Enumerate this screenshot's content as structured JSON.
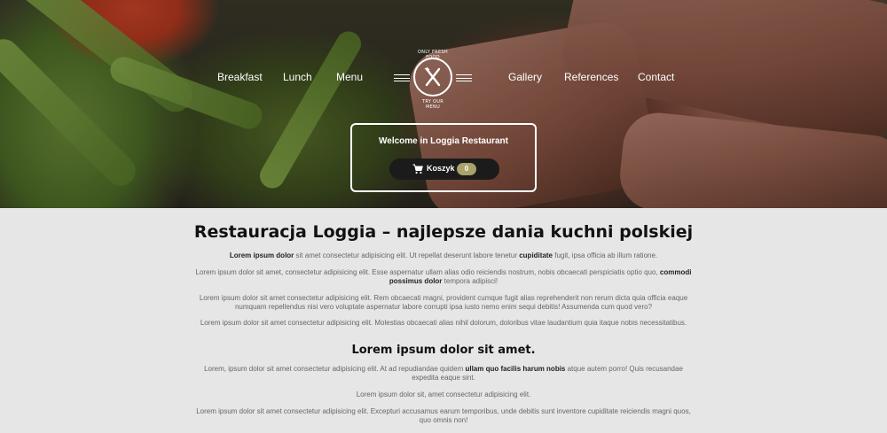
{
  "nav": {
    "breakfast": "Breakfast",
    "lunch": "Lunch",
    "menu": "Menu",
    "gallery": "Gallery",
    "references": "References",
    "contact": "Contact"
  },
  "logo": {
    "top_text": "ONLY FRESH FOOD",
    "bottom_text": "TRY OUR MENU"
  },
  "welcome": {
    "title": "Welcome in Loggia Restaurant",
    "cart_label": "Koszyk",
    "cart_count": "0"
  },
  "content": {
    "heading": "Restauracja Loggia – najlepsze dania kuchni polskiej",
    "p1_b1": "Lorem ipsum dolor",
    "p1_t1": " sit amet consectetur adipisicing elit. Ut repellat deserunt labore tenetur ",
    "p1_b2": "cupiditate",
    "p1_t2": " fugit, ipsa officia ab illum ratione.",
    "p2_t1": "Lorem ipsum dolor sit amet, consectetur adipisicing elit. Esse aspernatur ullam alias odio reiciendis nostrum, nobis obcaecati perspiciatis optio quo, ",
    "p2_b1": "commodi possimus dolor",
    "p2_t2": " tempora adipisci!",
    "p3": "Lorem ipsum dolor sit amet consectetur adipisicing elit. Rem obcaecati magni, provident cumque fugit alias reprehenderit non rerum dicta quia officia eaque numquam repellendus nisi vero voluptate aspernatur labore corrupti ipsa iusto nemo enim sequi debitis! Assumenda cum quod vero?",
    "p4": "Lorem ipsum dolor sit amet consectetur adipisicing elit. Molestias obcaecati alias nihil dolorum, doloribus vitae laudantium quia itaque nobis necessitatibus.",
    "subheading": "Lorem ipsum dolor sit amet.",
    "p5_t1": "Lorem, ipsum dolor sit amet consectetur adipisicing elit. At ad repudiandae quidem ",
    "p5_b1": "ullam quo facilis harum nobis",
    "p5_t2": " atque autem porro! Quis recusandae expedita eaque sint.",
    "p6": "Lorem ipsum dolor sit, amet consectetur adipisicing elit.",
    "p7": "Lorem ipsum dolor sit amet consectetur adipisicing elit. Excepturi accusamus earum temporibus, unde debitis sunt inventore cupiditate reiciendis magni quos, quo omnis non!"
  },
  "colors": {
    "content_bg": "#e6e6e6",
    "cart_badge": "#a9a26a",
    "cart_button": "#1b1b1b"
  }
}
